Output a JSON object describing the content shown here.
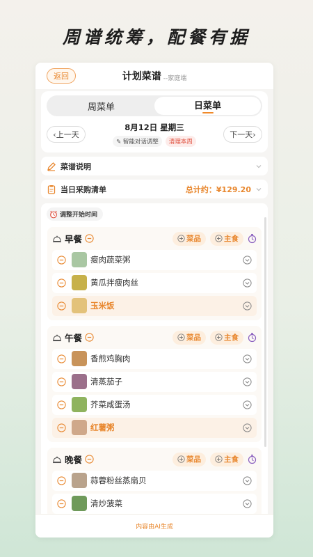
{
  "slogan": "周谱统筹，配餐有据",
  "header": {
    "back": "返回",
    "title": "计划菜谱",
    "subtitle": "--家庭端"
  },
  "tabs": {
    "week": "周菜单",
    "day": "日菜单"
  },
  "date": {
    "prev": "‹上一天",
    "next": "下一天›",
    "current": "8月12日 星期三",
    "ai_tag": "智能对话调整",
    "clear_tag": "清理本周"
  },
  "recipe_info": {
    "label": "菜谱说明"
  },
  "shopping": {
    "label": "当日采购清单",
    "total": "总计约：¥129.20"
  },
  "adjust_time": "调整开始时间",
  "add_dish": "菜品",
  "add_staple": "主食",
  "meals": [
    {
      "name": "早餐",
      "items": [
        {
          "name": "瘦肉蔬菜粥",
          "thumb": "#a9c7a3",
          "highlight": false
        },
        {
          "name": "黄瓜拌瘦肉丝",
          "thumb": "#c7b14a",
          "highlight": false
        },
        {
          "name": "玉米饭",
          "thumb": "#e3c27a",
          "highlight": true
        }
      ]
    },
    {
      "name": "午餐",
      "items": [
        {
          "name": "香煎鸡胸肉",
          "thumb": "#c8935a",
          "highlight": false
        },
        {
          "name": "清蒸茄子",
          "thumb": "#9b6f8a",
          "highlight": false
        },
        {
          "name": "芥菜咸蛋汤",
          "thumb": "#8fb35e",
          "highlight": false
        },
        {
          "name": "红薯粥",
          "thumb": "#cfa88a",
          "highlight": true
        }
      ]
    },
    {
      "name": "晚餐",
      "items": [
        {
          "name": "蒜蓉粉丝蒸扇贝",
          "thumb": "#b9a38c",
          "highlight": false
        },
        {
          "name": "清炒菠菜",
          "thumb": "#6f9a5a",
          "highlight": false
        }
      ]
    }
  ],
  "footer": "内容由AI生成",
  "colors": {
    "accent": "#e8872e",
    "danger": "#e0503f",
    "timer": "#8a5fbf"
  }
}
